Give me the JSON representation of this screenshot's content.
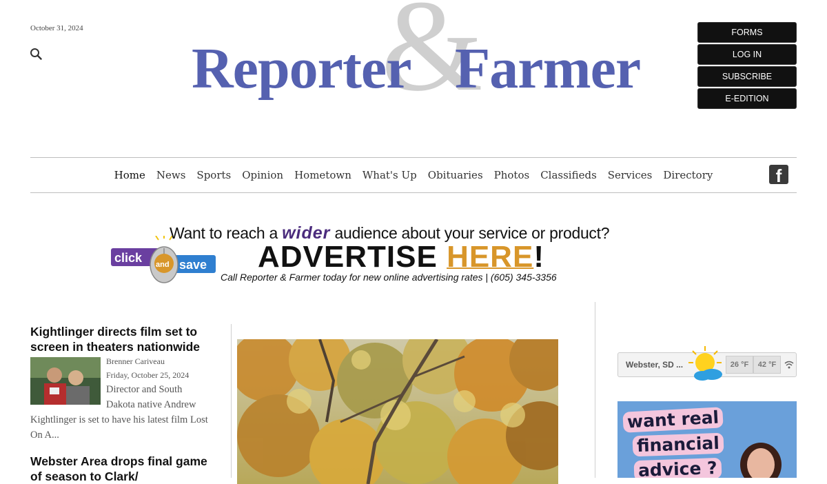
{
  "header": {
    "date": "October 31, 2024",
    "logo_word1": "Reporter",
    "logo_amp": "&",
    "logo_word2": "Farmer",
    "buttons": [
      "FORMS",
      "LOG IN",
      "SUBSCRIBE",
      "E-EDITION"
    ]
  },
  "nav": {
    "items": [
      "Home",
      "News",
      "Sports",
      "Opinion",
      "Hometown",
      "What's Up",
      "Obituaries",
      "Photos",
      "Classifieds",
      "Services",
      "Directory"
    ],
    "active": "Home"
  },
  "ad_banner": {
    "badge_click": "click",
    "badge_and": "and",
    "badge_save": "save",
    "line1_pre": "Want to reach a",
    "line1_em": "wider",
    "line1_post": "audience about your service or product?",
    "line2_pre": "ADVERTISE",
    "line2_here": "HERE",
    "line2_post": "!",
    "line3": "Call Reporter & Farmer today for new online advertising rates | (605) 345-3356"
  },
  "stories": [
    {
      "title": "Kightlinger directs film set to screen in theaters nationwide",
      "author": "Brenner Cariveau",
      "date": "Friday, October 25, 2024",
      "excerpt": "Director and South Dakota native Andrew Kightlinger is set to have his latest film Lost On A..."
    },
    {
      "title": "Webster Area drops final game of season to Clark/"
    }
  ],
  "weather": {
    "location": "Webster, SD ...",
    "low": "26 °F",
    "high": "42 °F"
  },
  "side_ad": {
    "line1": "want real",
    "line2": "financial",
    "line3": "advice ?"
  },
  "colors": {
    "logo_blue": "#5561b0",
    "logo_amp": "#cfcfcf",
    "button_bg": "#111111",
    "ad_purple": "#4b2c7d",
    "ad_orange": "#d8962a",
    "side_ad_bg": "#6aa0da"
  },
  "icons": [
    "search-icon",
    "facebook-icon",
    "weather-icon",
    "wifi-icon"
  ]
}
